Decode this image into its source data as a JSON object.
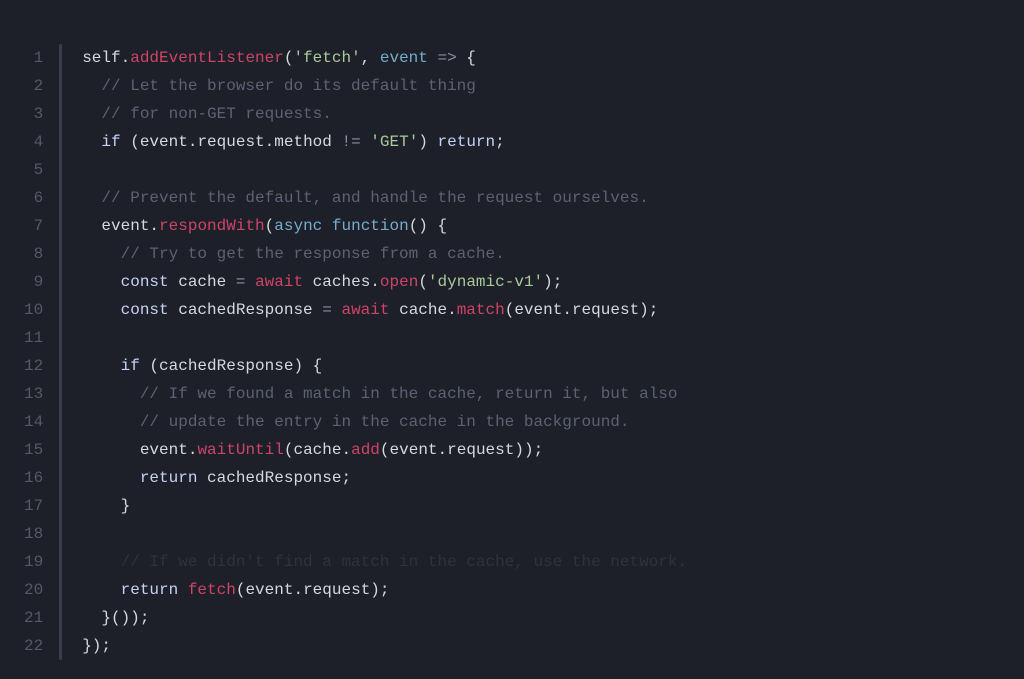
{
  "lineNumbers": [
    "1",
    "2",
    "3",
    "4",
    "5",
    "6",
    "7",
    "8",
    "9",
    "10",
    "11",
    "12",
    "13",
    "14",
    "15",
    "16",
    "17",
    "18",
    "19",
    "20",
    "21",
    "22"
  ],
  "code": {
    "lines": [
      {
        "dim": false,
        "tokens": [
          {
            "t": "self",
            "c": "default"
          },
          {
            "t": ".",
            "c": "punc"
          },
          {
            "t": "addEventListener",
            "c": "call"
          },
          {
            "t": "(",
            "c": "punc"
          },
          {
            "t": "'fetch'",
            "c": "string"
          },
          {
            "t": ", ",
            "c": "punc"
          },
          {
            "t": "event",
            "c": "param"
          },
          {
            "t": " ",
            "c": "default"
          },
          {
            "t": "=>",
            "c": "op"
          },
          {
            "t": " {",
            "c": "punc"
          }
        ]
      },
      {
        "dim": false,
        "tokens": [
          {
            "t": "  ",
            "c": "default"
          },
          {
            "t": "// Let the browser do its default thing",
            "c": "comment"
          }
        ]
      },
      {
        "dim": false,
        "tokens": [
          {
            "t": "  ",
            "c": "default"
          },
          {
            "t": "// for non-GET requests.",
            "c": "comment"
          }
        ]
      },
      {
        "dim": false,
        "tokens": [
          {
            "t": "  ",
            "c": "default"
          },
          {
            "t": "if",
            "c": "keyword"
          },
          {
            "t": " (",
            "c": "punc"
          },
          {
            "t": "event",
            "c": "default"
          },
          {
            "t": ".",
            "c": "punc"
          },
          {
            "t": "request",
            "c": "default"
          },
          {
            "t": ".",
            "c": "punc"
          },
          {
            "t": "method",
            "c": "default"
          },
          {
            "t": " ",
            "c": "default"
          },
          {
            "t": "!=",
            "c": "op"
          },
          {
            "t": " ",
            "c": "default"
          },
          {
            "t": "'GET'",
            "c": "string"
          },
          {
            "t": ") ",
            "c": "punc"
          },
          {
            "t": "return",
            "c": "keyword"
          },
          {
            "t": ";",
            "c": "punc"
          }
        ]
      },
      {
        "dim": false,
        "tokens": []
      },
      {
        "dim": false,
        "tokens": [
          {
            "t": "  ",
            "c": "default"
          },
          {
            "t": "// Prevent the default, and handle the request ourselves.",
            "c": "comment"
          }
        ]
      },
      {
        "dim": false,
        "tokens": [
          {
            "t": "  ",
            "c": "default"
          },
          {
            "t": "event",
            "c": "default"
          },
          {
            "t": ".",
            "c": "punc"
          },
          {
            "t": "respondWith",
            "c": "call"
          },
          {
            "t": "(",
            "c": "punc"
          },
          {
            "t": "async",
            "c": "param"
          },
          {
            "t": " ",
            "c": "default"
          },
          {
            "t": "function",
            "c": "param"
          },
          {
            "t": "() {",
            "c": "punc"
          }
        ]
      },
      {
        "dim": false,
        "tokens": [
          {
            "t": "    ",
            "c": "default"
          },
          {
            "t": "// Try to get the response from a cache.",
            "c": "comment"
          }
        ]
      },
      {
        "dim": false,
        "tokens": [
          {
            "t": "    ",
            "c": "default"
          },
          {
            "t": "const",
            "c": "keyword"
          },
          {
            "t": " cache ",
            "c": "default"
          },
          {
            "t": "=",
            "c": "op"
          },
          {
            "t": " ",
            "c": "default"
          },
          {
            "t": "await",
            "c": "call"
          },
          {
            "t": " caches",
            "c": "default"
          },
          {
            "t": ".",
            "c": "punc"
          },
          {
            "t": "open",
            "c": "call"
          },
          {
            "t": "(",
            "c": "punc"
          },
          {
            "t": "'dynamic-v1'",
            "c": "string"
          },
          {
            "t": ");",
            "c": "punc"
          }
        ]
      },
      {
        "dim": false,
        "tokens": [
          {
            "t": "    ",
            "c": "default"
          },
          {
            "t": "const",
            "c": "keyword"
          },
          {
            "t": " cachedResponse ",
            "c": "default"
          },
          {
            "t": "=",
            "c": "op"
          },
          {
            "t": " ",
            "c": "default"
          },
          {
            "t": "await",
            "c": "call"
          },
          {
            "t": " cache",
            "c": "default"
          },
          {
            "t": ".",
            "c": "punc"
          },
          {
            "t": "match",
            "c": "call"
          },
          {
            "t": "(",
            "c": "punc"
          },
          {
            "t": "event",
            "c": "default"
          },
          {
            "t": ".",
            "c": "punc"
          },
          {
            "t": "request",
            "c": "default"
          },
          {
            "t": ");",
            "c": "punc"
          }
        ]
      },
      {
        "dim": false,
        "tokens": []
      },
      {
        "dim": false,
        "tokens": [
          {
            "t": "    ",
            "c": "default"
          },
          {
            "t": "if",
            "c": "keyword"
          },
          {
            "t": " (",
            "c": "punc"
          },
          {
            "t": "cachedResponse",
            "c": "default"
          },
          {
            "t": ") {",
            "c": "punc"
          }
        ]
      },
      {
        "dim": false,
        "tokens": [
          {
            "t": "      ",
            "c": "default"
          },
          {
            "t": "// If we found a match in the cache, return it, but also",
            "c": "comment"
          }
        ]
      },
      {
        "dim": false,
        "tokens": [
          {
            "t": "      ",
            "c": "default"
          },
          {
            "t": "// update the entry in the cache in the background.",
            "c": "comment"
          }
        ]
      },
      {
        "dim": false,
        "tokens": [
          {
            "t": "      ",
            "c": "default"
          },
          {
            "t": "event",
            "c": "default"
          },
          {
            "t": ".",
            "c": "punc"
          },
          {
            "t": "waitUntil",
            "c": "call"
          },
          {
            "t": "(",
            "c": "punc"
          },
          {
            "t": "cache",
            "c": "default"
          },
          {
            "t": ".",
            "c": "punc"
          },
          {
            "t": "add",
            "c": "call"
          },
          {
            "t": "(",
            "c": "punc"
          },
          {
            "t": "event",
            "c": "default"
          },
          {
            "t": ".",
            "c": "punc"
          },
          {
            "t": "request",
            "c": "default"
          },
          {
            "t": "));",
            "c": "punc"
          }
        ]
      },
      {
        "dim": false,
        "tokens": [
          {
            "t": "      ",
            "c": "default"
          },
          {
            "t": "return",
            "c": "keyword"
          },
          {
            "t": " cachedResponse",
            "c": "default"
          },
          {
            "t": ";",
            "c": "punc"
          }
        ]
      },
      {
        "dim": false,
        "tokens": [
          {
            "t": "    }",
            "c": "punc"
          }
        ]
      },
      {
        "dim": false,
        "tokens": []
      },
      {
        "dim": true,
        "tokens": [
          {
            "t": "    ",
            "c": "default"
          },
          {
            "t": "// If we didn't find a match in the cache, use the network.",
            "c": "comment"
          }
        ]
      },
      {
        "dim": false,
        "tokens": [
          {
            "t": "    ",
            "c": "default"
          },
          {
            "t": "return",
            "c": "keyword"
          },
          {
            "t": " ",
            "c": "default"
          },
          {
            "t": "fetch",
            "c": "call"
          },
          {
            "t": "(",
            "c": "punc"
          },
          {
            "t": "event",
            "c": "default"
          },
          {
            "t": ".",
            "c": "punc"
          },
          {
            "t": "request",
            "c": "default"
          },
          {
            "t": ");",
            "c": "punc"
          }
        ]
      },
      {
        "dim": false,
        "tokens": [
          {
            "t": "  }());",
            "c": "punc"
          }
        ]
      },
      {
        "dim": false,
        "tokens": [
          {
            "t": "});",
            "c": "punc"
          }
        ]
      }
    ]
  }
}
